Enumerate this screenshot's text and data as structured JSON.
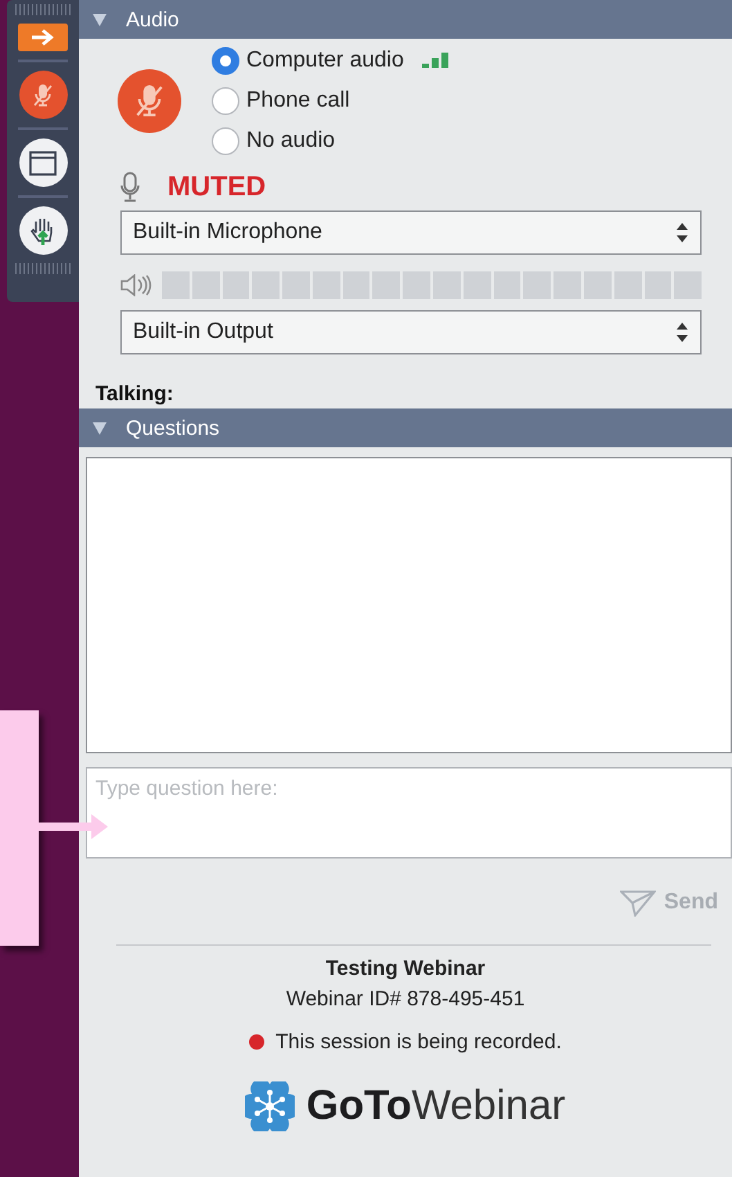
{
  "audio": {
    "title": "Audio",
    "expanded": true,
    "options": [
      {
        "label": "Computer audio",
        "selected": true
      },
      {
        "label": "Phone call",
        "selected": false
      },
      {
        "label": "No audio",
        "selected": false
      }
    ],
    "status": "MUTED",
    "microphone": "Built-in Microphone",
    "speaker_meter": {
      "level": 0
    },
    "speaker": "Built-in Output",
    "talking_label": "Talking:"
  },
  "questions": {
    "title": "Questions",
    "expanded": true,
    "placeholder": "Type question here:",
    "send": "Send"
  },
  "footer": {
    "title": "Testing Webinar",
    "webinar_id": "Webinar ID# 878-495-451",
    "recording": "This session is being recorded.",
    "logo_bold": "GoTo",
    "logo_light": "Webinar"
  }
}
